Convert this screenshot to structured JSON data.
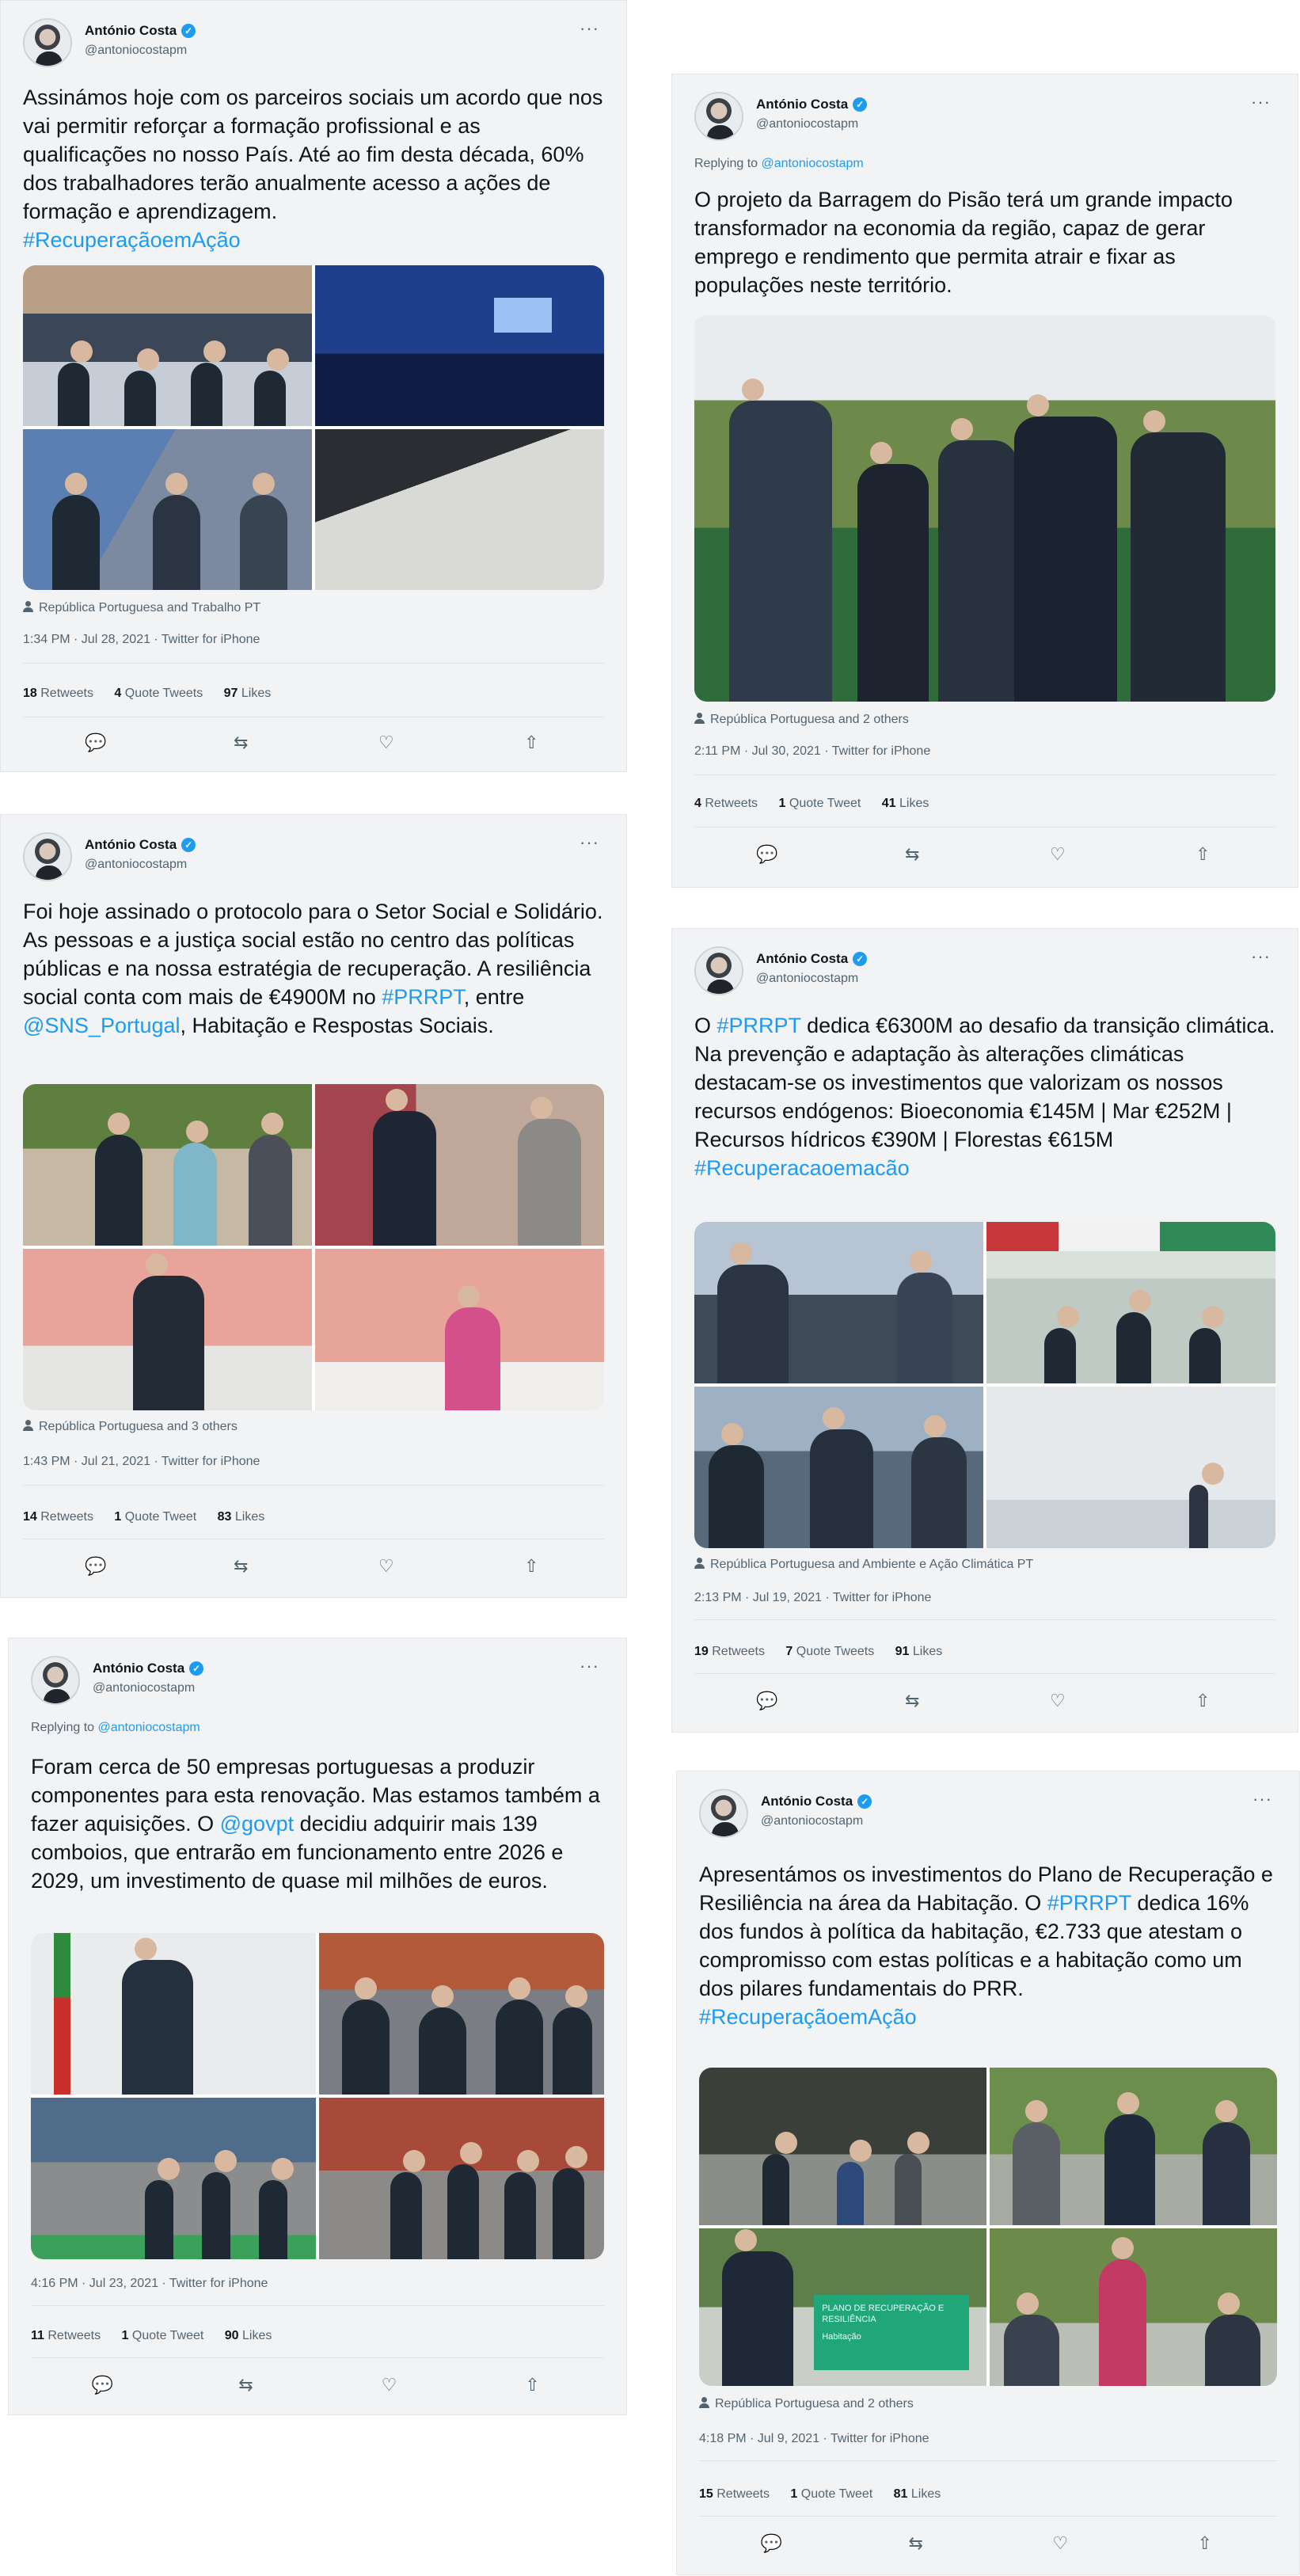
{
  "author": {
    "name": "António Costa",
    "handle": "@antoniocostapm",
    "verified": true
  },
  "colors": {
    "link": "#1d9bf0",
    "text": "#0f1419",
    "muted": "#536471",
    "card_bg": "#f2f3f5"
  },
  "icons": {
    "reply": "reply-icon",
    "retweet": "retweet-icon",
    "like": "heart-icon",
    "share": "share-icon",
    "more": "more-icon",
    "tagged": "person-icon"
  },
  "tweets": [
    {
      "text_before": "Assinámos hoje com os parceiros sociais um acordo que nos vai permitir reforçar a formação profissional e as qualificações no nosso País. Até ao fim desta década, 60% dos trabalhadores terão anualmente acesso a ações de formação e aprendizagem.",
      "hashtag": "#RecuperaçãoemAção",
      "tagged": "República Portuguesa and Trabalho PT",
      "time": "1:34 PM · Jul 28, 2021 · Twitter for iPhone",
      "retweets": "18",
      "retweets_label": "Retweets",
      "quotes": "4",
      "quotes_label": "Quote Tweets",
      "likes": "97",
      "likes_label": "Likes"
    },
    {
      "reply_prefix": "Replying to",
      "reply_to": "@antoniocostapm",
      "text": "O projeto da Barragem do Pisão terá um grande impacto transformador na economia da região, capaz de gerar emprego e rendimento que permita atrair e fixar as populações neste território.",
      "tagged": "República Portuguesa and 2 others",
      "time": "2:11 PM · Jul 30, 2021 · Twitter for iPhone",
      "retweets": "4",
      "retweets_label": "Retweets",
      "quotes": "1",
      "quotes_label": "Quote Tweet",
      "likes": "41",
      "likes_label": "Likes"
    },
    {
      "text_a": "Foi hoje assinado o protocolo para o Setor Social e Solidário. As pessoas e a justiça social estão no centro das políticas públicas e na nossa estratégia de recuperação. A resiliência social conta com mais de €4900M no ",
      "hashtag": "#PRRPT",
      "text_b": ", entre ",
      "mention": "@SNS_Portugal",
      "text_c": ", Habitação e Respostas Sociais.",
      "tagged": "República Portuguesa and 3 others",
      "time": "1:43 PM · Jul 21, 2021 · Twitter for iPhone",
      "retweets": "14",
      "retweets_label": "Retweets",
      "quotes": "1",
      "quotes_label": "Quote Tweet",
      "likes": "83",
      "likes_label": "Likes"
    },
    {
      "text_a": "O ",
      "hashtag": "#PRRPT",
      "text_b": " dedica €6300M ao desafio da transição climática. Na prevenção e adaptação às alterações climáticas destacam-se os investimentos que valorizam os nossos recursos endógenos: Bioeconomia €145M | Mar €252M | Recursos hídricos €390M | Florestas €615M",
      "hashtag2": "#Recuperacaoemacão",
      "tagged": "República Portuguesa and Ambiente e Ação Climática PT",
      "time": "2:13 PM · Jul 19, 2021 · Twitter for iPhone",
      "retweets": "19",
      "retweets_label": "Retweets",
      "quotes": "7",
      "quotes_label": "Quote Tweets",
      "likes": "91",
      "likes_label": "Likes"
    },
    {
      "reply_prefix": "Replying to",
      "reply_to": "@antoniocostapm",
      "text_a": "Foram cerca de 50 empresas portuguesas a produzir componentes para esta renovação. Mas estamos também a fazer aquisições. O ",
      "mention": "@govpt",
      "text_b": " decidiu adquirir mais 139 comboios, que entrarão em funcionamento entre 2026 e 2029, um investimento de quase mil milhões de euros.",
      "time": "4:16 PM · Jul 23, 2021 · Twitter for iPhone",
      "retweets": "11",
      "retweets_label": "Retweets",
      "quotes": "1",
      "quotes_label": "Quote Tweet",
      "likes": "90",
      "likes_label": "Likes"
    },
    {
      "text_a": "Apresentámos os investimentos do Plano de Recuperação e Resiliência na área da Habitação. O ",
      "hashtag": "#PRRPT",
      "text_b": " dedica 16% dos fundos à política da habitação, €2.733 que atestam o compromisso com estas políticas e a habitação como um dos pilares fundamentais do PRR.",
      "hashtag2": "#RecuperaçãoemAção",
      "banner_text": "PLANO DE RECUPERAÇÃO E RESILIÊNCIA",
      "banner_sub": "Habitação",
      "tagged": "República Portuguesa and 2 others",
      "time": "4:18 PM · Jul 9, 2021 · Twitter for iPhone",
      "retweets": "15",
      "retweets_label": "Retweets",
      "quotes": "1",
      "quotes_label": "Quote Tweet",
      "likes": "81",
      "likes_label": "Likes"
    }
  ],
  "actions": {
    "reply": "💬",
    "retweet": "⇆",
    "like": "♡",
    "share": "⇧",
    "more": "···"
  }
}
